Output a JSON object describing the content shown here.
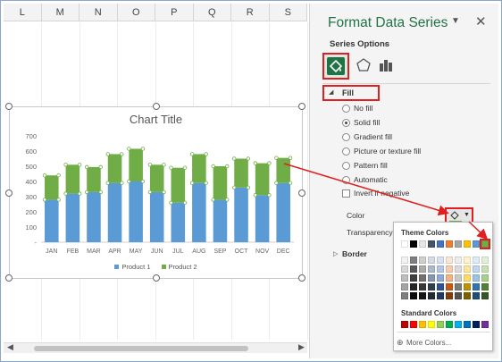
{
  "columns": [
    "L",
    "M",
    "N",
    "O",
    "P",
    "Q",
    "R",
    "S"
  ],
  "pane": {
    "title": "Format Data Series",
    "series_options": "Series Options",
    "fill_section": "Fill",
    "fill_options": [
      "No fill",
      "Solid fill",
      "Gradient fill",
      "Picture or texture fill",
      "Pattern fill",
      "Automatic"
    ],
    "selected_fill": "Solid fill",
    "invert": "Invert if negative",
    "color_label": "Color",
    "transparency_label": "Transparency",
    "border_section": "Border"
  },
  "popup": {
    "theme_colors": "Theme Colors",
    "standard_colors": "Standard Colors",
    "more_colors": "More Colors...",
    "theme_row": [
      "#ffffff",
      "#000000",
      "#e7e6e6",
      "#44546a",
      "#4472c4",
      "#ed7d31",
      "#a5a5a5",
      "#ffc000",
      "#5b9bd5",
      "#70ad47"
    ],
    "standard_row": [
      "#c00000",
      "#ff0000",
      "#ffc000",
      "#ffff00",
      "#92d050",
      "#00b050",
      "#00b0f0",
      "#0070c0",
      "#002060",
      "#7030a0"
    ],
    "selected": "#70ad47"
  },
  "colors": {
    "accent": "#217346",
    "highlight": "#e02020",
    "product1": "#5b9bd5",
    "product2": "#70ad47"
  },
  "chart_data": {
    "type": "bar",
    "stacked": true,
    "title": "Chart Title",
    "categories": [
      "JAN",
      "FEB",
      "MAR",
      "APR",
      "MAY",
      "JUN",
      "JUL",
      "AUG",
      "SEP",
      "OCT",
      "NOV",
      "DEC"
    ],
    "series": [
      {
        "name": "Product 1",
        "values": [
          280,
          320,
          330,
          390,
          400,
          330,
          260,
          390,
          280,
          360,
          310,
          390
        ],
        "color": "#5b9bd5"
      },
      {
        "name": "Product 2",
        "values": [
          160,
          190,
          165,
          190,
          215,
          180,
          230,
          190,
          220,
          190,
          210,
          165
        ],
        "color": "#70ad47"
      }
    ],
    "yticks": [
      "-",
      "100",
      "200",
      "300",
      "400",
      "500",
      "600",
      "700"
    ],
    "ylim": [
      0,
      700
    ],
    "legend": "bottom"
  }
}
